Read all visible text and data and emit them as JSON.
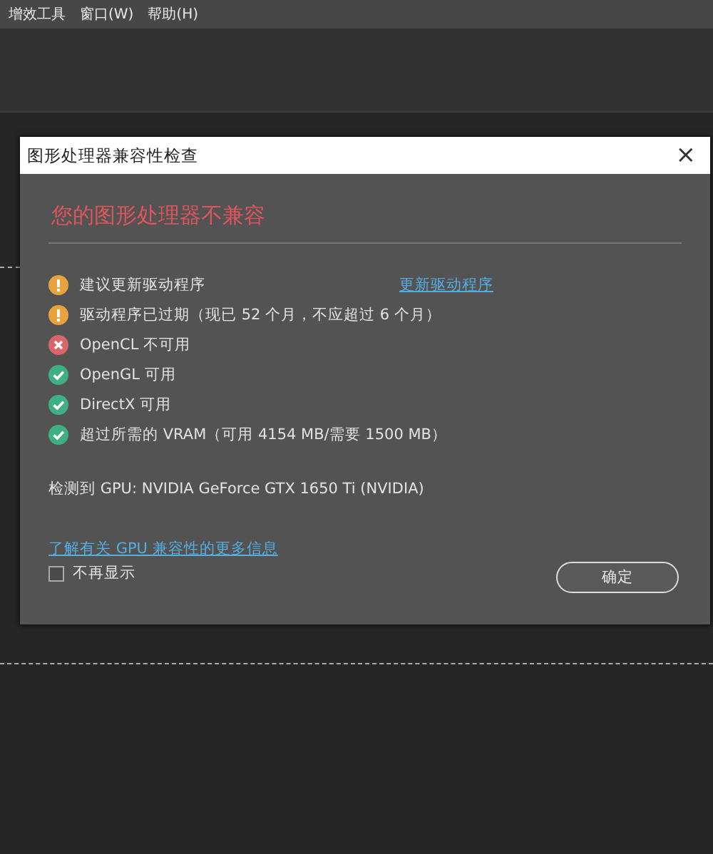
{
  "menu_bar": {
    "items": [
      "增效工具",
      "窗口(W)",
      "帮助(H)"
    ]
  },
  "dialog": {
    "title": "图形处理器兼容性检查",
    "close": "×",
    "heading": "您的图形处理器不兼容",
    "checks": [
      {
        "kind": "warning",
        "text": "建议更新驱动程序",
        "link": "更新驱动程序"
      },
      {
        "kind": "warning",
        "text": "驱动程序已过期（现已 52 个月，不应超过 6 个月）"
      },
      {
        "kind": "error",
        "text": "OpenCL 不可用"
      },
      {
        "kind": "ok",
        "text": "OpenGL 可用"
      },
      {
        "kind": "ok",
        "text": "DirectX 可用"
      },
      {
        "kind": "ok",
        "text": "超过所需的 VRAM（可用 4154 MB/需要 1500 MB）"
      }
    ],
    "gpu": "检测到 GPU: NVIDIA GeForce GTX 1650 Ti (NVIDIA)",
    "more_info_link": "了解有关 GPU 兼容性的更多信息",
    "dont_show": {
      "label": "不再显示",
      "checked": false
    },
    "ok_button": "确定"
  }
}
